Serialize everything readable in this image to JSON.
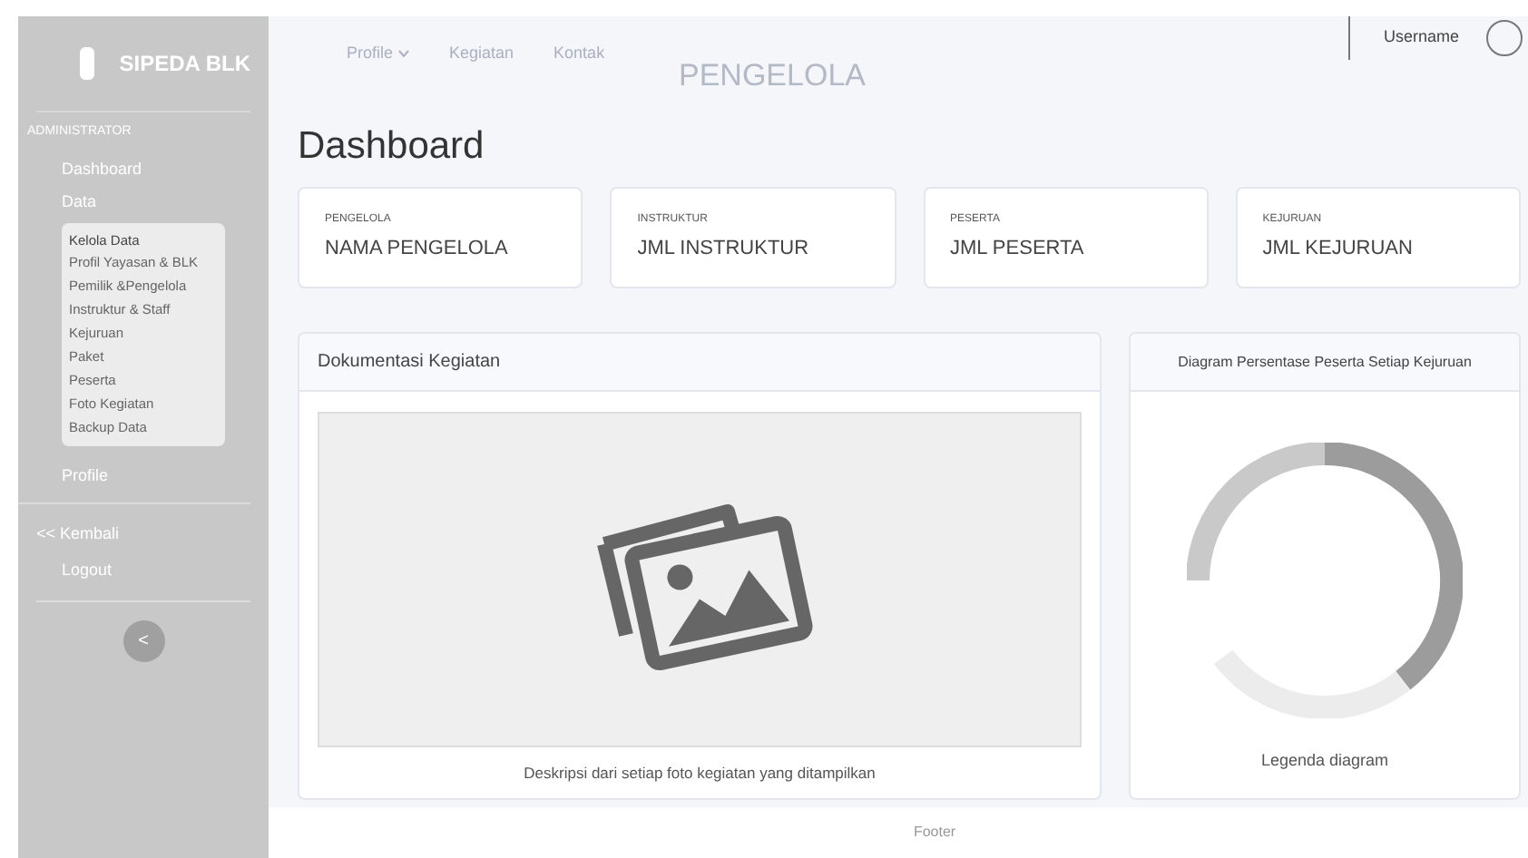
{
  "sidebar": {
    "brand": "SIPEDA BLK",
    "section": "ADMINISTRATOR",
    "items": [
      "Dashboard",
      "Data"
    ],
    "submenu": {
      "heading": "Kelola Data",
      "items": [
        "Profil Yayasan & BLK",
        "Pemilik &Pengelola",
        "Instruktur & Staff",
        "Kejuruan",
        "Paket",
        "Peserta",
        "Foto Kegiatan",
        "Backup Data"
      ]
    },
    "items_after": [
      "Profile"
    ],
    "back": "<< Kembali",
    "logout": "Logout",
    "collapse_symbol": "<"
  },
  "topbar": {
    "nav": [
      "Profile",
      "Kegiatan",
      "Kontak"
    ],
    "heading": "PENGELOLA",
    "username": "Username"
  },
  "page_title": "Dashboard",
  "stats": [
    {
      "label": "PENGELOLA",
      "value": "NAMA PENGELOLA"
    },
    {
      "label": "INSTRUKTUR",
      "value": "JML INSTRUKTUR"
    },
    {
      "label": "PESERTA",
      "value": "JML PESERTA"
    },
    {
      "label": "KEJURUAN",
      "value": "JML KEJURUAN"
    }
  ],
  "gallery": {
    "title": "Dokumentasi Kegiatan",
    "caption": "Deskripsi dari setiap foto kegiatan yang ditampilkan"
  },
  "chart_panel": {
    "title": "Diagram Persentase Peserta Setiap Kejuruan",
    "legend": "Legenda diagram"
  },
  "footer": "Footer"
}
